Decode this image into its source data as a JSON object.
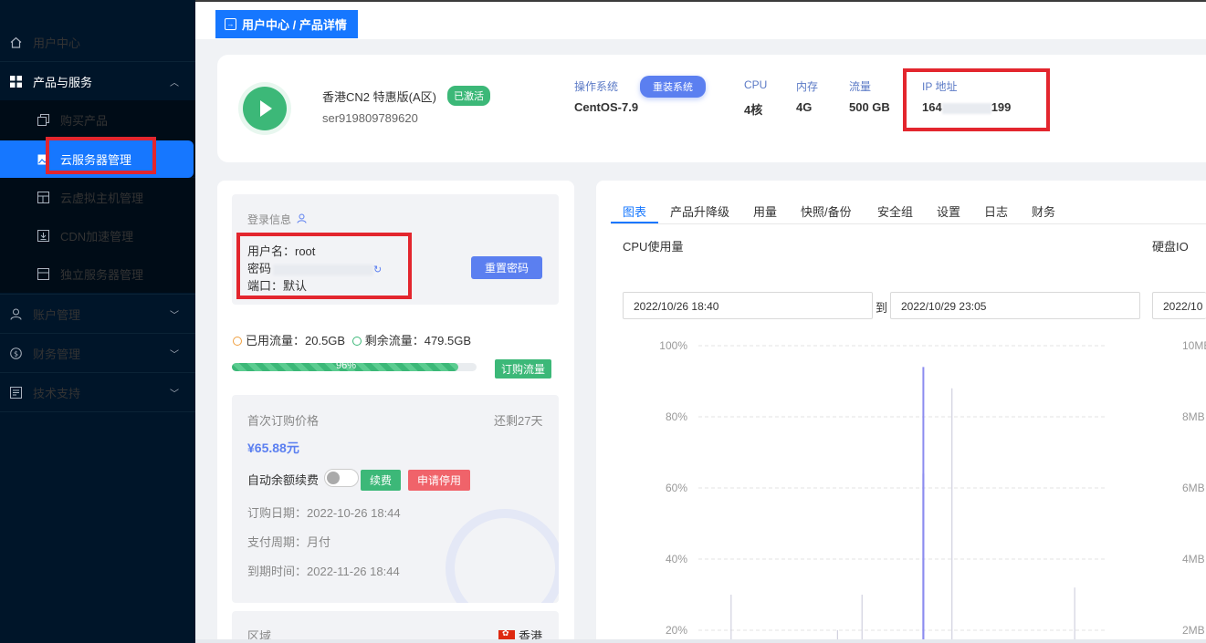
{
  "sidebar": {
    "items": [
      {
        "label": "用户中心",
        "icon": "home-icon"
      },
      {
        "label": "产品与服务",
        "icon": "grid-icon",
        "expanded": true
      },
      {
        "label": "购买产品",
        "icon": "copy-icon"
      },
      {
        "label": "云服务器管理",
        "icon": "image-icon",
        "active": true
      },
      {
        "label": "云虚拟主机管理",
        "icon": "layout-icon"
      },
      {
        "label": "CDN加速管理",
        "icon": "download-box-icon"
      },
      {
        "label": "独立服务器管理",
        "icon": "server-icon"
      },
      {
        "label": "账户管理",
        "icon": "user-icon"
      },
      {
        "label": "财务管理",
        "icon": "dollar-icon"
      },
      {
        "label": "技术支持",
        "icon": "document-icon"
      }
    ],
    "active_color": "#1677ff"
  },
  "breadcrumb": {
    "text": "用户中心 / 产品详情"
  },
  "product": {
    "name": "香港CN2 特惠版(A区)",
    "status": "已激活",
    "id": "ser919809789620",
    "os_label": "操作系统",
    "os_value": "CentOS-7.9",
    "reinstall_label": "重装系统",
    "cpu_label": "CPU",
    "cpu_value": "4核",
    "mem_label": "内存",
    "mem_value": "4G",
    "traffic_label": "流量",
    "traffic_value": "500 GB",
    "ip_label": "IP 地址",
    "ip_prefix": "164",
    "ip_suffix": "199"
  },
  "login": {
    "title": "登录信息",
    "username": "用户名：root",
    "password_label": "密码",
    "port": "端口：默认",
    "reset_label": "重置密码"
  },
  "traffic": {
    "used": "已用流量：20.5GB",
    "remaining": "剩余流量：479.5GB",
    "percent_text": "96%",
    "bar_fill_fraction": 0.96,
    "buy_label": "订购流量"
  },
  "order": {
    "title": "首次订购价格",
    "remaining": "还剩27天",
    "price": "¥65.88元",
    "auto_renew_label": "自动余额续费",
    "renew_label": "续费",
    "stop_label": "申请停用",
    "order_date": "订购日期：2022-10-26 18:44",
    "pay_cycle": "支付周期：月付",
    "expire": "到期时间：2022-11-26 18:44"
  },
  "region": {
    "label": "区域",
    "value": "香港"
  },
  "tabs": [
    "图表",
    "产品升降级",
    "用量",
    "快照/备份",
    "安全组",
    "设置",
    "日志",
    "财务"
  ],
  "charts": {
    "cpu_title": "CPU使用量",
    "disk_title": "硬盘IO",
    "date_from": "2022/10/26   18:40",
    "date_to_sep": "到",
    "date_to": "2022/10/29   23:05",
    "disk_date": "2022/10"
  },
  "chart_data": [
    {
      "type": "line",
      "title": "CPU使用量",
      "y_ticks": [
        "100%",
        "80%",
        "60%",
        "40%",
        "20%"
      ],
      "ylim": [
        0,
        100
      ],
      "series": [
        {
          "color": "#8c8cf0",
          "spikes": [
            {
              "x": 0.55,
              "y": 94
            },
            {
              "x": 0.55,
              "y": 64
            },
            {
              "x": 0.62,
              "y": 88
            },
            {
              "x": 0.08,
              "y": 30
            },
            {
              "x": 0.34,
              "y": 20
            },
            {
              "x": 0.4,
              "y": 30
            },
            {
              "x": 0.92,
              "y": 32
            }
          ]
        }
      ]
    },
    {
      "type": "line",
      "title": "硬盘IO",
      "y_ticks": [
        "10MB",
        "8MB",
        "6MB",
        "4MB",
        "2MB"
      ]
    }
  ]
}
